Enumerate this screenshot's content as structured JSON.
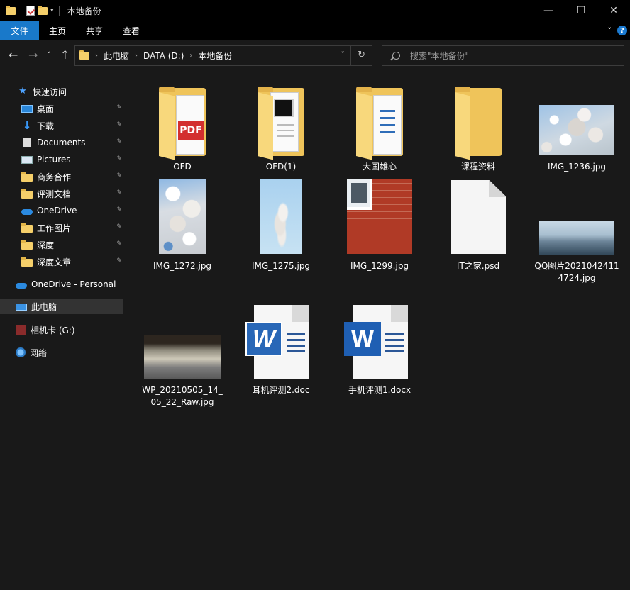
{
  "window": {
    "title": "本地备份",
    "controls": {
      "minimize": "—",
      "maximize": "☐",
      "close": "✕"
    }
  },
  "ribbon": {
    "tabs": [
      "文件",
      "主页",
      "共享",
      "查看"
    ],
    "expand": "˅",
    "help": "?"
  },
  "nav": {
    "back": "←",
    "forward": "→",
    "recent": "˅",
    "up": "↑"
  },
  "address": {
    "crumbs": [
      "此电脑",
      "DATA (D:)",
      "本地备份"
    ],
    "separator": "›",
    "dropdown": "˅",
    "refresh": "↻"
  },
  "search": {
    "placeholder": "搜索\"本地备份\""
  },
  "sidebar": {
    "quick_access": "快速访问",
    "items": [
      {
        "label": "桌面",
        "icon": "desktop-icon",
        "pinned": true
      },
      {
        "label": "下载",
        "icon": "download-icon",
        "pinned": true
      },
      {
        "label": "Documents",
        "icon": "document-icon",
        "pinned": true
      },
      {
        "label": "Pictures",
        "icon": "pictures-icon",
        "pinned": true
      },
      {
        "label": "商务合作",
        "icon": "folder-icon",
        "pinned": true
      },
      {
        "label": "评测文档",
        "icon": "folder-icon",
        "pinned": true
      },
      {
        "label": "OneDrive",
        "icon": "onedrive-icon",
        "pinned": true
      },
      {
        "label": "工作图片",
        "icon": "folder-icon",
        "pinned": true
      },
      {
        "label": "深度",
        "icon": "folder-icon",
        "pinned": true
      },
      {
        "label": "深度文章",
        "icon": "folder-icon",
        "pinned": true
      }
    ],
    "onedrive_personal": "OneDrive - Personal",
    "this_pc": "此电脑",
    "camera_card": "相机卡 (G:)",
    "network": "网络"
  },
  "files": [
    {
      "name": "OFD",
      "kind": "folder-pdf"
    },
    {
      "name": "OFD(1)",
      "kind": "folder-screen"
    },
    {
      "name": "大国雄心",
      "kind": "folder-doc"
    },
    {
      "name": "课程资料",
      "kind": "folder-empty"
    },
    {
      "name": "IMG_1236.jpg",
      "kind": "photo-landscape"
    },
    {
      "name": "IMG_1272.jpg",
      "kind": "photo-portrait"
    },
    {
      "name": "IMG_1275.jpg",
      "kind": "photo-portrait"
    },
    {
      "name": "IMG_1299.jpg",
      "kind": "photo-brick"
    },
    {
      "name": "IT之家.psd",
      "kind": "blank-file"
    },
    {
      "name": "QQ图片20210424114724.jpg",
      "kind": "photo-wide"
    },
    {
      "name": "WP_20210505_14_05_22_Raw.jpg",
      "kind": "photo-road"
    },
    {
      "name": "耳机评测2.doc",
      "kind": "word-doc"
    },
    {
      "name": "手机评测1.docx",
      "kind": "word-docx"
    }
  ],
  "word_letter": "W",
  "pdf_label": "PDF",
  "pin_glyph": "📌"
}
